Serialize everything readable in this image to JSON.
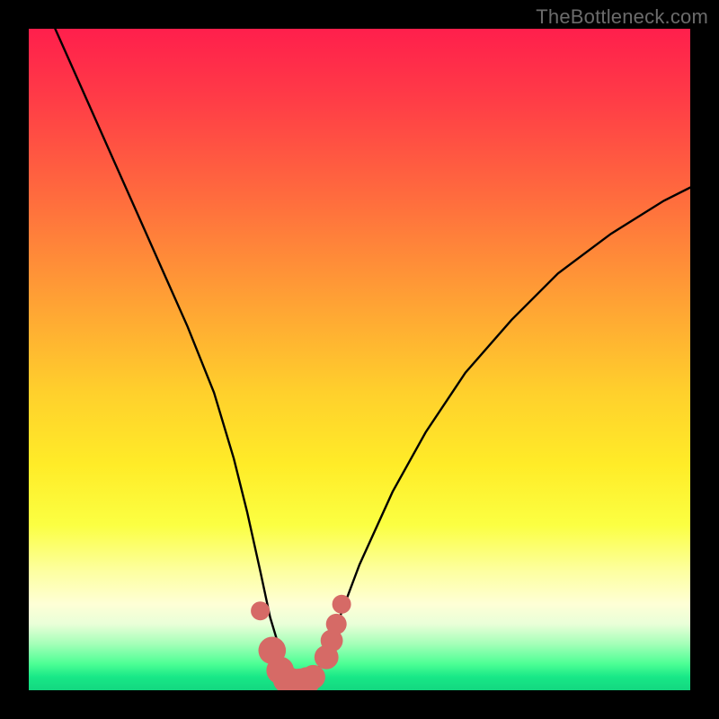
{
  "watermark": "TheBottleneck.com",
  "chart_data": {
    "type": "line",
    "title": "",
    "xlabel": "",
    "ylabel": "",
    "xlim": [
      0,
      100
    ],
    "ylim": [
      0,
      100
    ],
    "series": [
      {
        "name": "bottleneck-curve",
        "x": [
          4,
          8,
          12,
          16,
          20,
          24,
          28,
          31,
          33,
          35,
          36.5,
          38,
          39,
          40,
          41,
          42,
          43.5,
          45,
          47,
          50,
          55,
          60,
          66,
          73,
          80,
          88,
          96,
          100
        ],
        "y": [
          100,
          91,
          82,
          73,
          64,
          55,
          45,
          35,
          27,
          18,
          11,
          6,
          2.5,
          1.2,
          1.0,
          1.2,
          2.5,
          6,
          11,
          19,
          30,
          39,
          48,
          56,
          63,
          69,
          74,
          76
        ]
      }
    ],
    "markers": {
      "name": "highlight-dots",
      "color": "#d66a66",
      "points": [
        {
          "x": 35.0,
          "y": 12.0,
          "r": 1.1
        },
        {
          "x": 36.8,
          "y": 6.0,
          "r": 1.6
        },
        {
          "x": 38.0,
          "y": 3.0,
          "r": 1.6
        },
        {
          "x": 39.0,
          "y": 1.6,
          "r": 1.6
        },
        {
          "x": 40.0,
          "y": 1.2,
          "r": 1.6
        },
        {
          "x": 41.0,
          "y": 1.2,
          "r": 1.6
        },
        {
          "x": 42.0,
          "y": 1.4,
          "r": 1.6
        },
        {
          "x": 43.0,
          "y": 2.0,
          "r": 1.4
        },
        {
          "x": 45.0,
          "y": 5.0,
          "r": 1.4
        },
        {
          "x": 45.8,
          "y": 7.5,
          "r": 1.3
        },
        {
          "x": 46.5,
          "y": 10.0,
          "r": 1.2
        },
        {
          "x": 47.3,
          "y": 13.0,
          "r": 1.1
        }
      ]
    },
    "gradient_stops": [
      {
        "pos": 0.0,
        "color": "#ff1f4c"
      },
      {
        "pos": 0.25,
        "color": "#ff6a3e"
      },
      {
        "pos": 0.55,
        "color": "#ffd02c"
      },
      {
        "pos": 0.82,
        "color": "#fdffa0"
      },
      {
        "pos": 0.93,
        "color": "#a4ffb8"
      },
      {
        "pos": 1.0,
        "color": "#13d780"
      }
    ]
  }
}
